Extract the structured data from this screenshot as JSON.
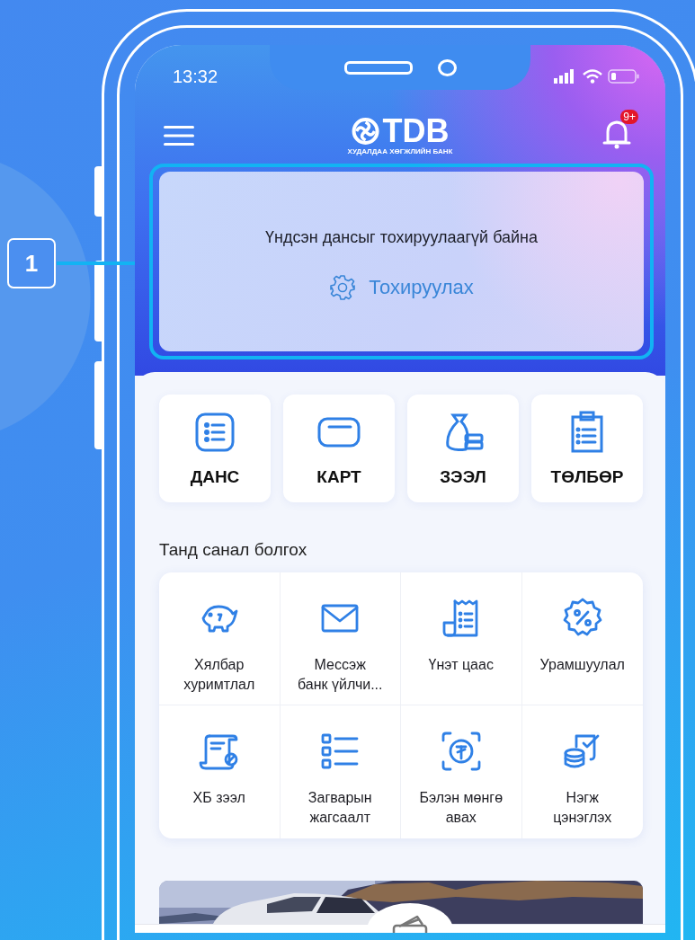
{
  "callout": {
    "number": "1"
  },
  "status_bar": {
    "time": "13:32"
  },
  "header": {
    "logo_text": "TDB",
    "logo_subtitle": "ХУДАЛДАА ХӨГЖЛИЙН БАНК",
    "notification_badge": "9+"
  },
  "account_notice": {
    "message": "Үндсэн дансыг тохируулаагүй байна",
    "action": "Тохируулах"
  },
  "main_tiles": [
    {
      "label": "ДАНС"
    },
    {
      "label": "КАРТ"
    },
    {
      "label": "ЗЭЭЛ"
    },
    {
      "label": "ТӨЛБӨР"
    }
  ],
  "offers": {
    "title": "Танд санал болгох",
    "items": [
      {
        "label": "Хялбар\nхуримтлал"
      },
      {
        "label": "Мессэж\nбанк үйлчи..."
      },
      {
        "label": "Үнэт цаас"
      },
      {
        "label": "Урамшуулал"
      },
      {
        "label": "ХБ зээл"
      },
      {
        "label": "Загварын\nжагсаалт"
      },
      {
        "label": "Бэлэн мөнгө\nавах"
      },
      {
        "label": "Нэгж\nцэнэглэх"
      }
    ]
  }
}
